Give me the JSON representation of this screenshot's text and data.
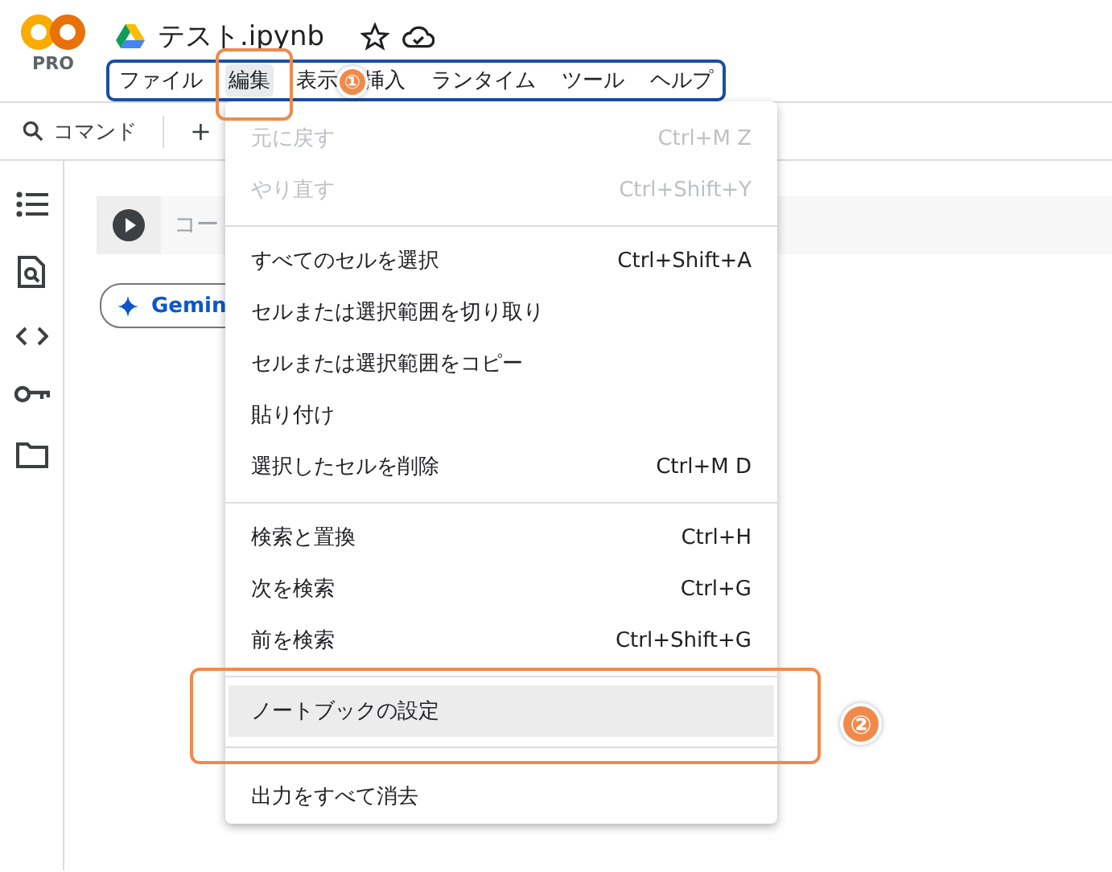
{
  "logo": {
    "badge": "PRO"
  },
  "document": {
    "title": "テスト.ipynb",
    "starred": false
  },
  "menubar": [
    {
      "label": "ファイル",
      "selected": false
    },
    {
      "label": "編集",
      "selected": true
    },
    {
      "label": "表示",
      "selected": false
    },
    {
      "label": "挿入",
      "selected": false
    },
    {
      "label": "ランタイム",
      "selected": false
    },
    {
      "label": "ツール",
      "selected": false
    },
    {
      "label": "ヘルプ",
      "selected": false
    }
  ],
  "toolbar": {
    "command_label": "コマンド",
    "add_label": "+"
  },
  "cell": {
    "placeholder": "コー"
  },
  "gemini_button": "Gemin",
  "edit_menu": [
    [
      {
        "label": "元に戻す",
        "shortcut": "Ctrl+M Z",
        "disabled": true,
        "selected": false
      },
      {
        "label": "やり直す",
        "shortcut": "Ctrl+Shift+Y",
        "disabled": true,
        "selected": false
      }
    ],
    [
      {
        "label": "すべてのセルを選択",
        "shortcut": "Ctrl+Shift+A",
        "disabled": false,
        "selected": false
      },
      {
        "label": "セルまたは選択範囲を切り取り",
        "disabled": false,
        "selected": false
      },
      {
        "label": "セルまたは選択範囲をコピー",
        "disabled": false,
        "selected": false
      },
      {
        "label": "貼り付け",
        "disabled": false,
        "selected": false
      },
      {
        "label": "選択したセルを削除",
        "shortcut": "Ctrl+M D",
        "disabled": false,
        "selected": false
      }
    ],
    [
      {
        "label": "検索と置換",
        "shortcut": "Ctrl+H",
        "disabled": false,
        "selected": false
      },
      {
        "label": "次を検索",
        "shortcut": "Ctrl+G",
        "disabled": false,
        "selected": false
      },
      {
        "label": "前を検索",
        "shortcut": "Ctrl+Shift+G",
        "disabled": false,
        "selected": false
      }
    ],
    [
      {
        "label": "ノートブックの設定",
        "disabled": false,
        "selected": true
      }
    ],
    [
      {
        "label": "出力をすべて消去",
        "disabled": false,
        "selected": false
      }
    ]
  ],
  "callouts": [
    "①",
    "②"
  ]
}
